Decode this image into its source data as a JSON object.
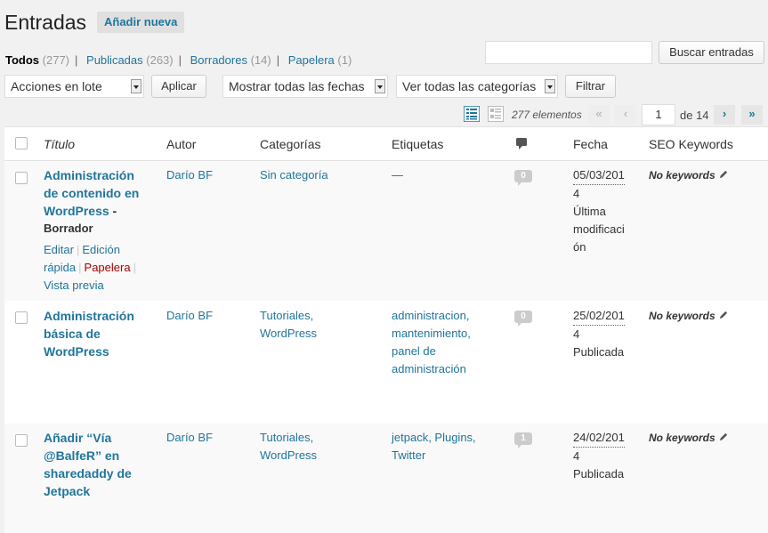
{
  "header": {
    "title": "Entradas",
    "add_new": "Añadir nueva"
  },
  "views": [
    {
      "label": "Todos",
      "count": "(277)"
    },
    {
      "label": "Publicadas",
      "count": "(263)"
    },
    {
      "label": "Borradores",
      "count": "(14)"
    },
    {
      "label": "Papelera",
      "count": "(1)"
    }
  ],
  "search": {
    "value": "",
    "button": "Buscar entradas"
  },
  "tablenav": {
    "bulk_actions": "Acciones en lote",
    "apply": "Aplicar",
    "dates": "Mostrar todas las fechas",
    "categories": "Ver todas las categorías",
    "filter": "Filtrar"
  },
  "pagination": {
    "items": "277 elementos",
    "first": "«",
    "prev": "‹",
    "current_page": "1",
    "of_total": "de 14",
    "next": "›",
    "last": "»"
  },
  "columns": {
    "title": "Título",
    "author": "Autor",
    "categories": "Categorías",
    "tags": "Etiquetas",
    "date": "Fecha",
    "seo": "SEO Keywords"
  },
  "rows": [
    {
      "title_lines": [
        "Administración",
        "de contenido en",
        "WordPress"
      ],
      "title_suffix": " -",
      "state": "Borrador",
      "actions": {
        "edit": "Editar",
        "quick_edit_1": "Edición",
        "quick_edit_2": "rápida",
        "trash": "Papelera",
        "preview": "Vista previa"
      },
      "author": "Darío BF",
      "categories": [
        "Sin categoría"
      ],
      "tags": [
        "—"
      ],
      "comments": "0",
      "date_lines": [
        "05/03/201",
        "4"
      ],
      "status_lines": [
        "Última",
        "modificaci",
        "ón"
      ],
      "seo": "No keywords"
    },
    {
      "title_lines": [
        "Administración",
        "básica de",
        "WordPress"
      ],
      "author": "Darío BF",
      "categories": [
        "Tutoriales,",
        "WordPress"
      ],
      "tags": [
        "administracion,",
        "mantenimiento,",
        "panel de",
        "administración"
      ],
      "comments": "0",
      "date_lines": [
        "25/02/201",
        "4"
      ],
      "status_lines": [
        "Publicada"
      ],
      "seo": "No keywords"
    },
    {
      "title_lines": [
        "Añadir “Vía",
        "@BalfeR” en",
        "sharedaddy de",
        "Jetpack"
      ],
      "author": "Darío BF",
      "categories": [
        "Tutoriales,",
        "WordPress"
      ],
      "tags": [
        "jetpack, Plugins,",
        "Twitter"
      ],
      "comments": "1",
      "date_lines": [
        "24/02/201",
        "4"
      ],
      "status_lines": [
        "Publicada"
      ],
      "seo": "No keywords"
    }
  ],
  "icons": {
    "list_view": "list-view-icon",
    "excerpt_view": "excerpt-view-icon",
    "comment": "comment-bubble-icon",
    "pencil": "pencil-icon"
  }
}
